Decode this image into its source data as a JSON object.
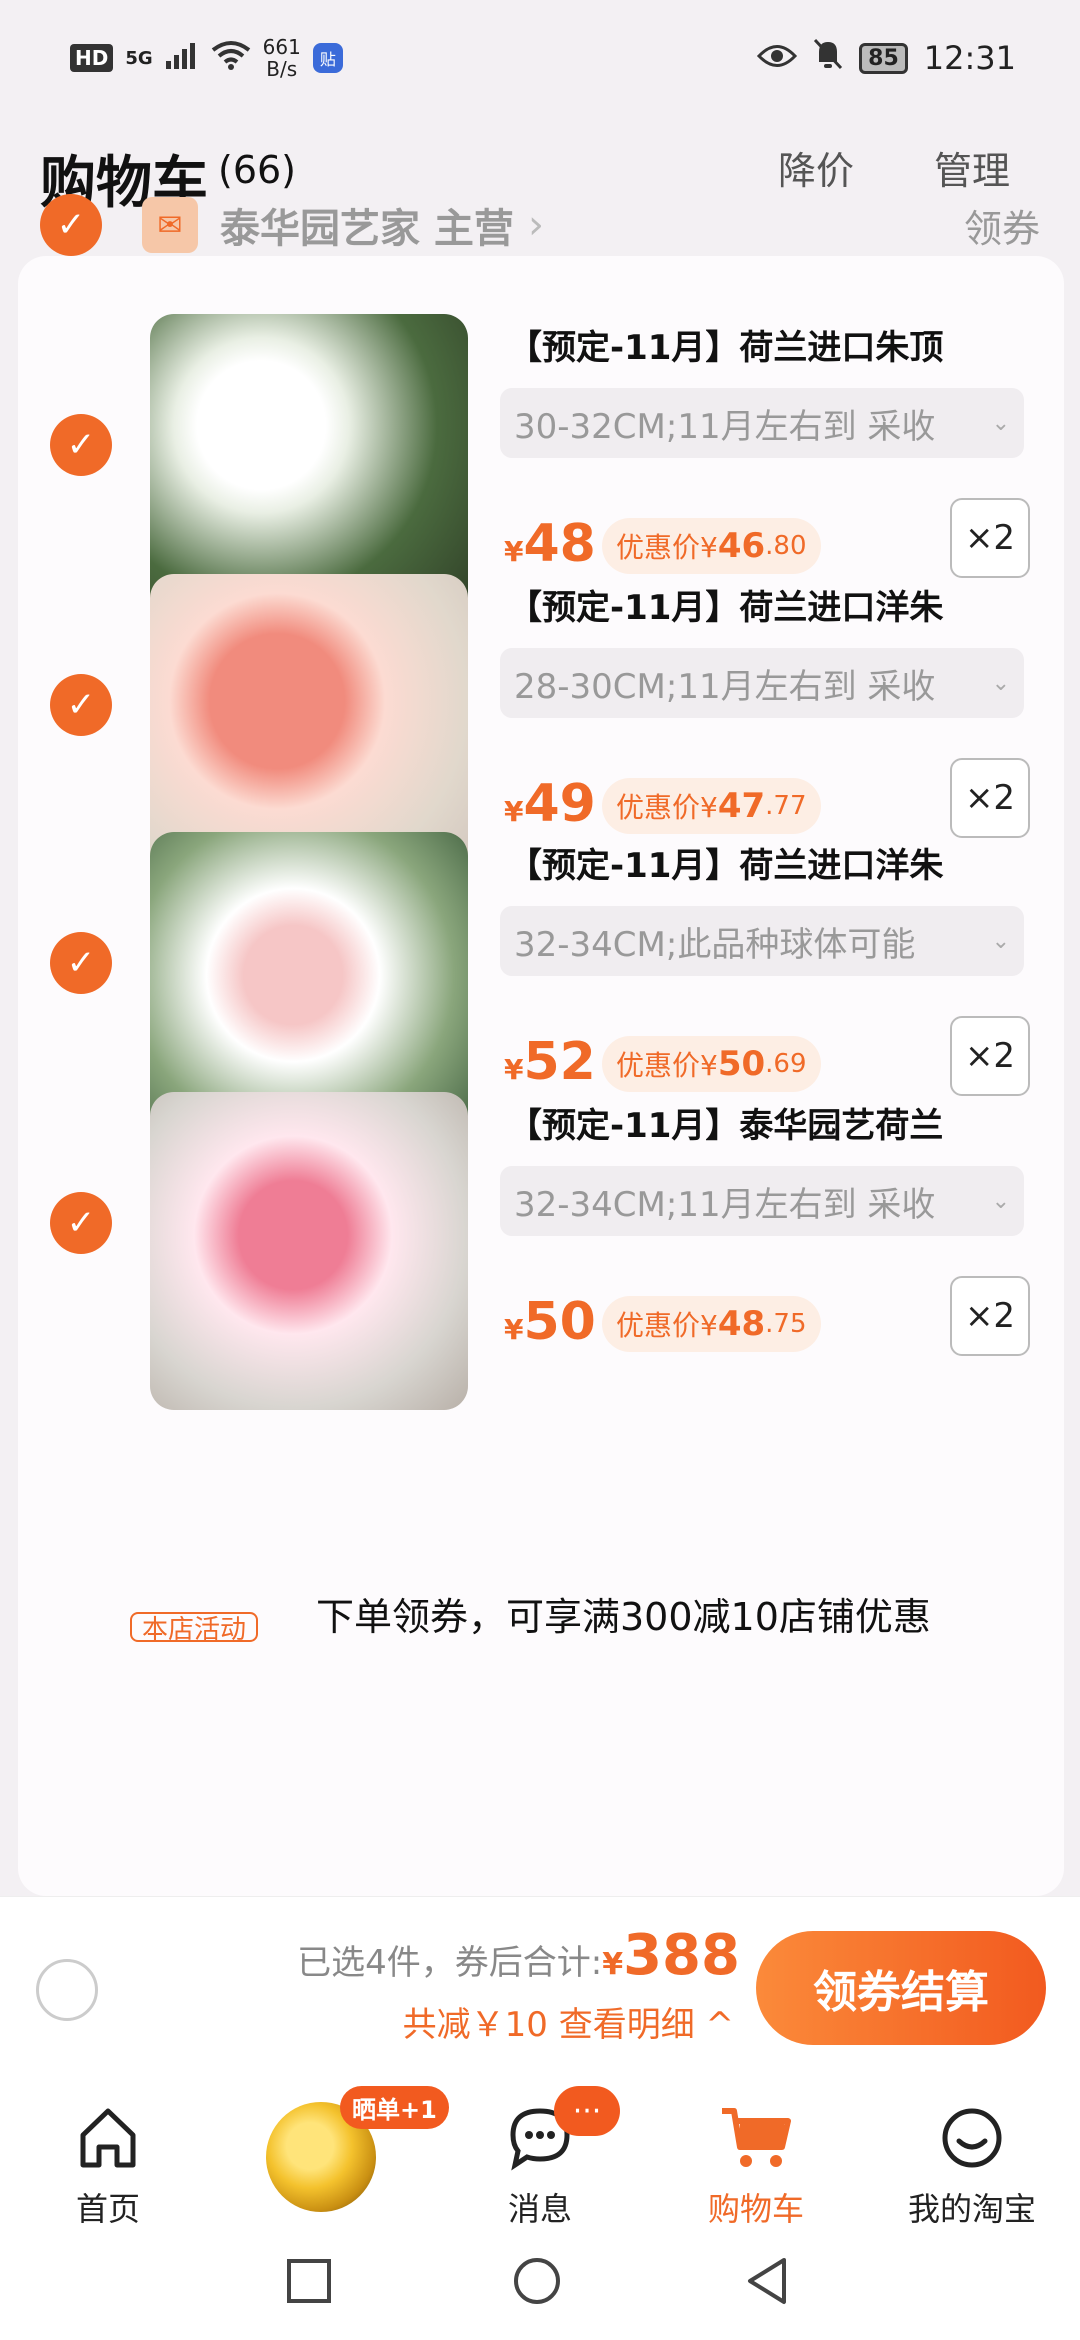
{
  "status_bar": {
    "hd": "HD",
    "network": "5G",
    "speed_value": "661",
    "speed_unit": "B/s",
    "app_badge": "贴",
    "battery": "85",
    "time": "12:31"
  },
  "header": {
    "title": "购物车",
    "count": "(66)",
    "price_drop": "降价",
    "manage": "管理"
  },
  "store": {
    "name": "泰华园艺家 主营",
    "coupon": "领券"
  },
  "items": [
    {
      "title": "【预定-11月】荷兰进口朱顶",
      "sku": "30-32CM;11月左右到 采收",
      "price": "48",
      "deal_label": "优惠价¥",
      "deal_int": "46",
      "deal_dec": ".80",
      "qty": "×2"
    },
    {
      "title": "【预定-11月】荷兰进口洋朱",
      "sku": "28-30CM;11月左右到 采收",
      "price": "49",
      "deal_label": "优惠价¥",
      "deal_int": "47",
      "deal_dec": ".77",
      "qty": "×2"
    },
    {
      "title": "【预定-11月】荷兰进口洋朱",
      "sku": "32-34CM;此品种球体可能",
      "price": "52",
      "deal_label": "优惠价¥",
      "deal_int": "50",
      "deal_dec": ".69",
      "qty": "×2"
    },
    {
      "title": "【预定-11月】泰华园艺荷兰",
      "sku": "32-34CM;11月左右到 采收",
      "price": "50",
      "deal_label": "优惠价¥",
      "deal_int": "48",
      "deal_dec": ".75",
      "qty": "×2"
    }
  ],
  "promo": {
    "tag": "本店活动",
    "text": "下单领券，可享满300减10店铺优惠"
  },
  "checkout": {
    "summary_label": "已选4件，券后合计:",
    "currency": "¥",
    "total": "388",
    "saved": "共减￥10 查看明细 ^",
    "button": "领券结算"
  },
  "tabbar": {
    "home": "首页",
    "sunbadge": "晒单+1",
    "messages": "消息",
    "messages_badge": "···",
    "cart": "购物车",
    "mine": "我的淘宝"
  },
  "colors": {
    "accent": "#f06a28",
    "accent_dark": "#f25a1f",
    "page_bg": "#f3f0f3"
  }
}
